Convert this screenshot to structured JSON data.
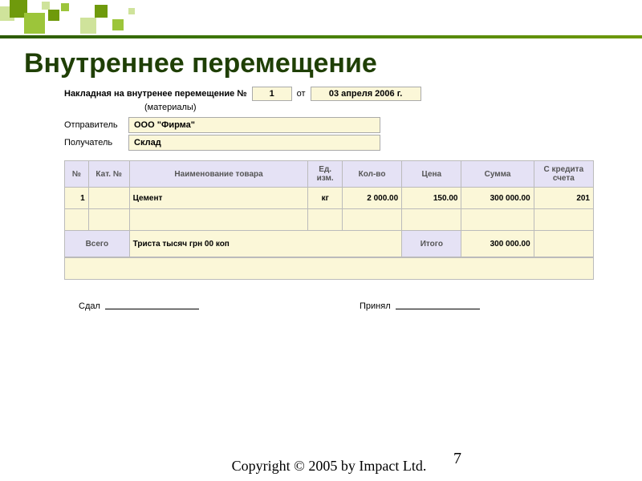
{
  "page_title": "Внутреннее перемещение",
  "doc": {
    "title_prefix": "Накладная на внутренее перемещение №",
    "number": "1",
    "ot": "от",
    "date": "03 апреля 2006 г.",
    "subtitle": "(материалы)",
    "sender_label": "Отправитель",
    "sender_value": "ООО \"Фирма\"",
    "receiver_label": "Получатель",
    "receiver_value": "Склад"
  },
  "table": {
    "headers": {
      "no": "№",
      "cat": "Кат. №",
      "name": "Наименование товара",
      "unit": "Ед. изм.",
      "qty": "Кол-во",
      "price": "Цена",
      "sum": "Сумма",
      "credit": "С кредита счета"
    },
    "rows": [
      {
        "no": "1",
        "cat": "",
        "name": "Цемент",
        "unit": "кг",
        "qty": "2 000.00",
        "price": "150.00",
        "sum": "300 000.00",
        "credit": "201"
      }
    ],
    "totals": {
      "all_label": "Всего",
      "amount_words": "Триста тысяч грн 00 коп",
      "itogo_label": "Итого",
      "itogo_value": "300 000.00"
    }
  },
  "sign": {
    "sent": "Сдал",
    "received": "Принял"
  },
  "footer": {
    "copyright": "Copyright © 2005 by Impact Ltd.",
    "slide": "7"
  }
}
